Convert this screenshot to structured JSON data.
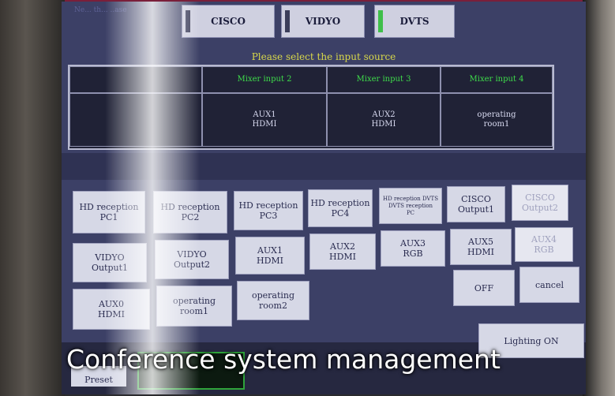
{
  "tabs": [
    {
      "label": "CISCO",
      "active": false
    },
    {
      "label": "VIDYO",
      "active": false
    },
    {
      "label": "DVTS",
      "active": true
    }
  ],
  "corner_text": "Ne... th... ..ase",
  "prompt": "Please select the input source",
  "mixer": {
    "headers": [
      "",
      "Mixer input 2",
      "Mixer input 3",
      "Mixer input 4"
    ],
    "values": [
      "",
      "AUX1\nHDMI",
      "AUX2\nHDMI",
      "operating\nroom1"
    ]
  },
  "buttons": {
    "row1": [
      "HD reception\nPC1",
      "HD reception\nPC2",
      "HD reception\nPC3",
      "HD reception\nPC4",
      "HD reception DVTS\nDVTS reception\nPC",
      "CISCO\nOutput1",
      "CISCO\nOutput2"
    ],
    "row2": [
      "VIDYO\nOutput1",
      "VIDYO\nOutput2",
      "AUX1\nHDMI",
      "AUX2\nHDMI",
      "AUX3\nRGB",
      "AUX5\nHDMI",
      "AUX4\nRGB"
    ],
    "row3": [
      "AUX0\nHDMI",
      "operating\nroom1",
      "operating\nroom2"
    ],
    "off": "OFF",
    "cancel": "cancel",
    "lighting": "Lighting ON"
  },
  "preset_label": "Preset",
  "overlay_title": "Conference system management",
  "colors": {
    "screen_bg": "#3c4066",
    "button_bg": "#d6d8e6",
    "header_text": "#3edc4a",
    "prompt_text": "#d8d84a",
    "active_indicator": "#3fbf4a"
  }
}
